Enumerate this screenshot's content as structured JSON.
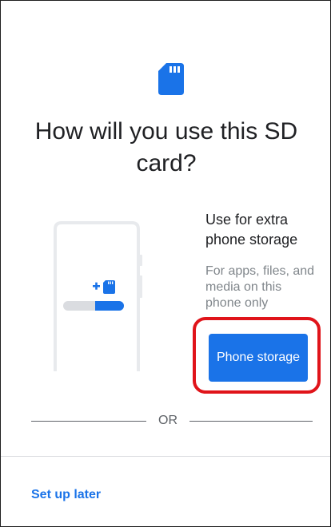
{
  "title": "How will you use this SD card?",
  "option": {
    "title": "Use for extra phone storage",
    "subtitle": "For apps, files, and media on this phone only",
    "button_label": "Phone storage"
  },
  "divider_label": "OR",
  "footer": {
    "setup_later_label": "Set up later"
  },
  "icons": {
    "header": "sd-card-icon",
    "illustration": "phone-illustration",
    "add_sd": "add-sd-card-icon"
  },
  "colors": {
    "accent": "#1a73e8",
    "highlight": "#e0141a",
    "secondary_text": "#80868b"
  }
}
